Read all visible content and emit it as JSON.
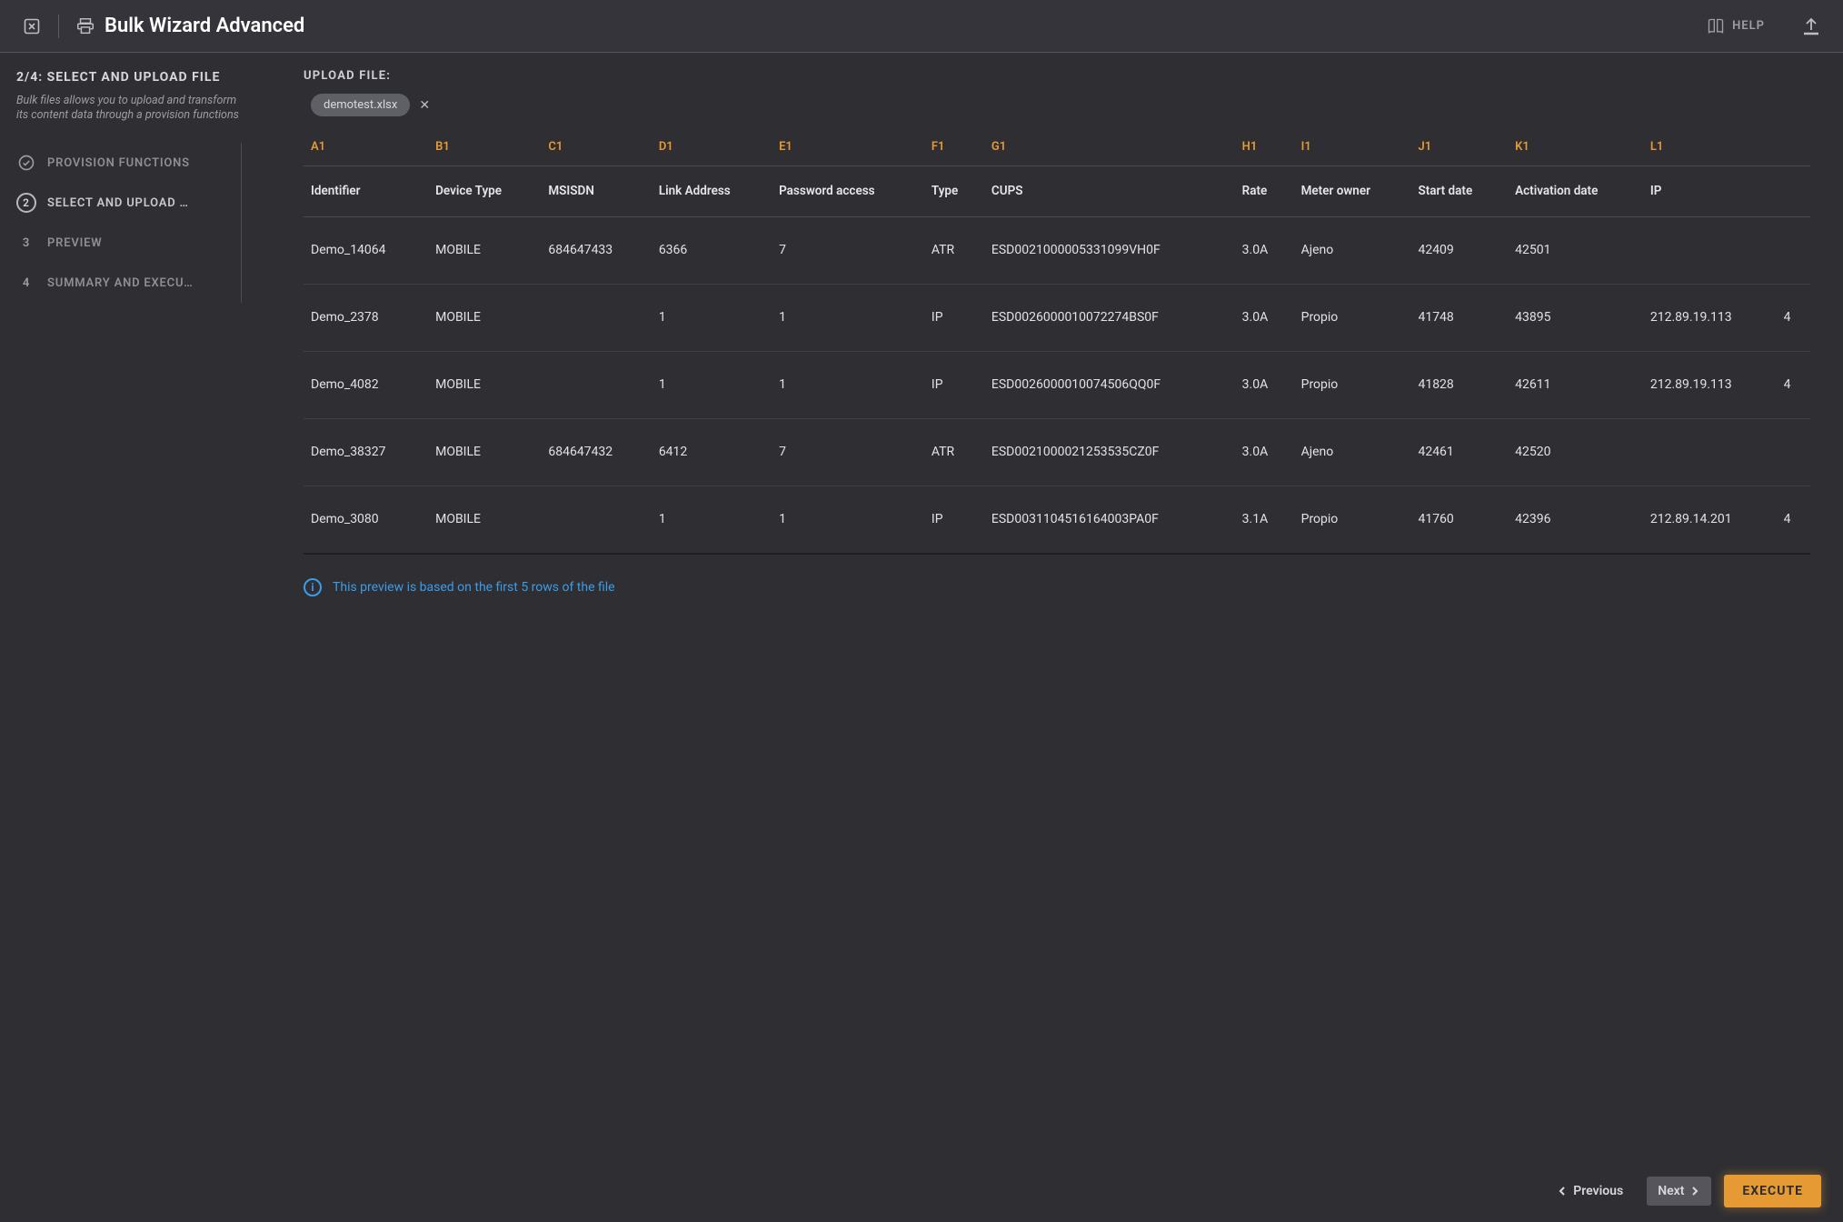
{
  "header": {
    "title": "Bulk Wizard Advanced",
    "help_label": "HELP"
  },
  "sidebar": {
    "heading": "2/4: SELECT AND UPLOAD FILE",
    "description": "Bulk files allows you to upload and transform its content data through a provision functions",
    "steps": [
      {
        "num": "",
        "label": "PROVISION FUNCTIONS",
        "state": "done"
      },
      {
        "num": "2",
        "label": "SELECT AND UPLOAD …",
        "state": "current"
      },
      {
        "num": "3",
        "label": "PREVIEW",
        "state": "todo"
      },
      {
        "num": "4",
        "label": "SUMMARY AND EXECU…",
        "state": "todo"
      }
    ]
  },
  "main": {
    "upload_label": "UPLOAD FILE:",
    "file_chip": "demotest.xlsx",
    "info_note": "This preview is based on the first 5 rows of the file"
  },
  "table": {
    "letter_row": [
      "A1",
      "B1",
      "C1",
      "D1",
      "E1",
      "F1",
      "G1",
      "H1",
      "I1",
      "J1",
      "K1",
      "L1"
    ],
    "headers": [
      "Identifier",
      "Device Type",
      "MSISDN",
      "Link Address",
      "Password access",
      "Type",
      "CUPS",
      "Rate",
      "Meter owner",
      "Start date",
      "Activation date",
      "IP"
    ],
    "rows": [
      [
        "Demo_14064",
        "MOBILE",
        "684647433",
        "6366",
        "7",
        "ATR",
        "ESD0021000005331099VH0F",
        "3.0A",
        "Ajeno",
        "42409",
        "42501",
        ""
      ],
      [
        "Demo_2378",
        "MOBILE",
        "",
        "1",
        "1",
        "IP",
        "ESD0026000010072274BS0F",
        "3.0A",
        "Propio",
        "41748",
        "43895",
        "212.89.19.113"
      ],
      [
        "Demo_4082",
        "MOBILE",
        "",
        "1",
        "1",
        "IP",
        "ESD0026000010074506QQ0F",
        "3.0A",
        "Propio",
        "41828",
        "42611",
        "212.89.19.113"
      ],
      [
        "Demo_38327",
        "MOBILE",
        "684647432",
        "6412",
        "7",
        "ATR",
        "ESD0021000021253535CZ0F",
        "3.0A",
        "Ajeno",
        "42461",
        "42520",
        ""
      ],
      [
        "Demo_3080",
        "MOBILE",
        "",
        "1",
        "1",
        "IP",
        "ESD0031104516164003PA0F",
        "3.1A",
        "Propio",
        "41760",
        "42396",
        "212.89.14.201"
      ]
    ],
    "overflow_hint": [
      "",
      "4",
      "4",
      "",
      "4"
    ]
  },
  "footer": {
    "previous_label": "Previous",
    "next_label": "Next",
    "execute_label": "EXECUTE"
  }
}
